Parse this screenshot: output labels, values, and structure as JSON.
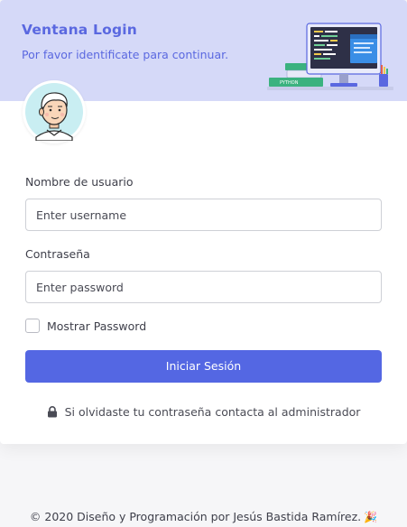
{
  "header": {
    "title": "Ventana Login",
    "subtitle": "Por favor identificate para continuar.",
    "illustration_book_label": "PYTHON"
  },
  "form": {
    "username": {
      "label": "Nombre de usuario",
      "placeholder": "Enter username",
      "value": ""
    },
    "password": {
      "label": "Contraseña",
      "placeholder": "Enter password",
      "value": ""
    },
    "show_password": {
      "label": "Mostrar Password",
      "checked": false
    },
    "submit_label": "Iniciar Sesión"
  },
  "forgot_text": "Si olvidaste tu contraseña contacta al administrador",
  "footer": {
    "text": "© 2020 Diseño y Programación por Jesús Bastida Ramírez.",
    "emoji": "🎉"
  },
  "colors": {
    "accent": "#5467e3",
    "header_bg": "#d5d9f8",
    "header_text": "#5a68e0",
    "page_bg": "#f6f6f8"
  }
}
